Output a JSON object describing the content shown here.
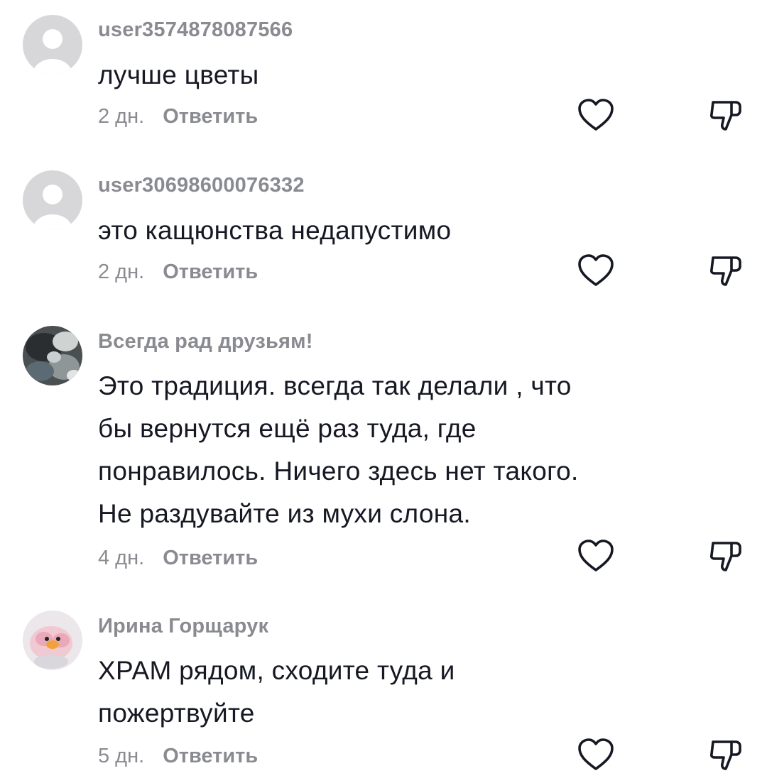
{
  "comments": [
    {
      "username": "user3574878087566",
      "text": "лучше цветы",
      "time": "2 дн.",
      "reply_label": "Ответить",
      "avatar_icon": "default-avatar-icon"
    },
    {
      "username": "user3069860007633​2",
      "text": "это кащюнства недапустимо",
      "time": "2 дн.",
      "reply_label": "Ответить",
      "avatar_icon": "default-avatar-icon"
    },
    {
      "username": "Всегда рад друзьям!",
      "text_lines": [
        "Это традиция. всегда так делали , что",
        "бы вернутся ещё раз туда, где",
        "понравилось. Ничего здесь нет такого.",
        "Не раздувайте из мухи слона."
      ],
      "time": "4 дн.",
      "reply_label": "Ответить",
      "avatar_icon": "photo-avatar-icon"
    },
    {
      "username": "Ирина Горщарук",
      "text_lines": [
        "ХРАМ рядом, сходите туда и",
        "пожертвуйте"
      ],
      "time": "5 дн.",
      "reply_label": "Ответить",
      "avatar_icon": "photo-avatar-icon"
    }
  ],
  "icons": {
    "like": "heart-icon",
    "dislike": "thumbs-down-icon"
  },
  "colors": {
    "text": "#161823",
    "secondary": "#8a8b91",
    "icon": "#161823",
    "default_avatar_bg": "#d7d7d9"
  }
}
